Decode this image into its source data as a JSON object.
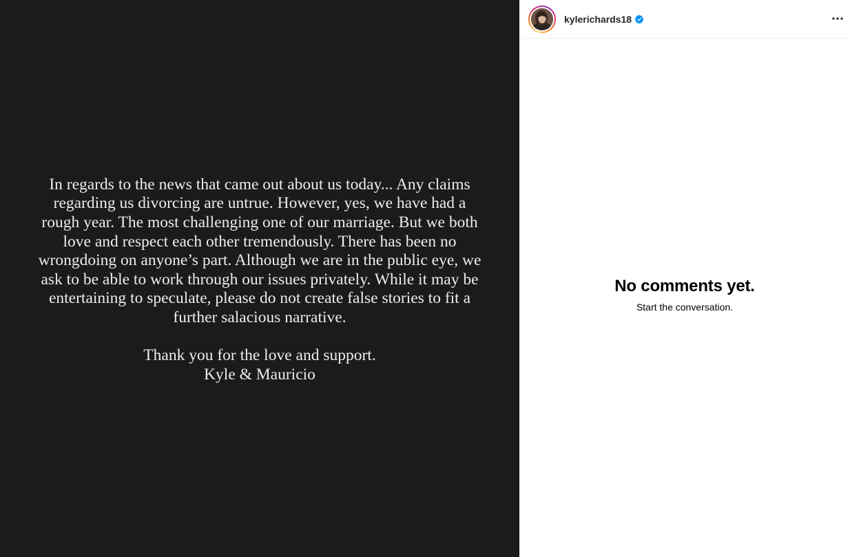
{
  "post": {
    "statement_lines": [
      "In regards to the news that came out about us today... Any claims",
      "regarding us divorcing are untrue. However, yes, we have had a",
      "rough year. The most challenging one of our marriage. But we both",
      "love and respect each other tremendously. There has been no",
      "wrongdoing on anyone’s part.  Although we are in the public eye, we",
      "ask to be able to work through our issues privately. While it may be",
      "entertaining to speculate, please do not create false stories to fit a",
      "further salacious narrative."
    ],
    "closing_lines": [
      "Thank you for the love and support.",
      "Kyle & Mauricio"
    ],
    "background_color": "#1b1b1b",
    "text_color": "#ededed"
  },
  "header": {
    "username": "kylerichards18",
    "verified_icon": "verified-badge-icon",
    "more_icon": "more-options-icon",
    "verified_color": "#0095f6"
  },
  "comments": {
    "empty_title": "No comments yet.",
    "empty_subtitle": "Start the conversation."
  }
}
